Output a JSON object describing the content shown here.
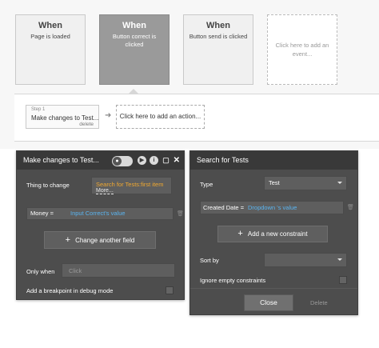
{
  "events": [
    {
      "when": "When",
      "desc": "Page is loaded"
    },
    {
      "when": "When",
      "desc": "Button correct is clicked"
    },
    {
      "when": "When",
      "desc": "Button send is clicked"
    }
  ],
  "add_event_label": "Click here to add an event...",
  "workflow": {
    "step_number": "Step 1",
    "step_title": "Make changes to Test...",
    "step_delete": "delete",
    "add_action_label": "Click here to add an action..."
  },
  "left_panel": {
    "title": "Make changes to Test...",
    "thing_label": "Thing to change",
    "thing_value": "Search for Tests:first item",
    "thing_more": "More...",
    "field_name": "Money =",
    "field_value": "Input Correct's value",
    "change_field_label": "Change another field",
    "only_when_label": "Only when",
    "only_when_placeholder": "Click",
    "breakpoint_label": "Add a breakpoint in debug mode"
  },
  "right_panel": {
    "title": "Search for Tests",
    "type_label": "Type",
    "type_value": "Test",
    "constraint_field": "Created Date =",
    "constraint_value": "Dropdown 's value",
    "add_constraint_label": "Add a new constraint",
    "sort_label": "Sort by",
    "ignore_label": "Ignore empty constraints",
    "close_label": "Close",
    "delete_label": "Delete"
  },
  "colors": {
    "panel_bg": "#4d4d4d",
    "header_bg": "#393939",
    "expression_orange": "#f0a830",
    "value_blue": "#5ab4f0",
    "selected_event": "#9a9a9a"
  }
}
